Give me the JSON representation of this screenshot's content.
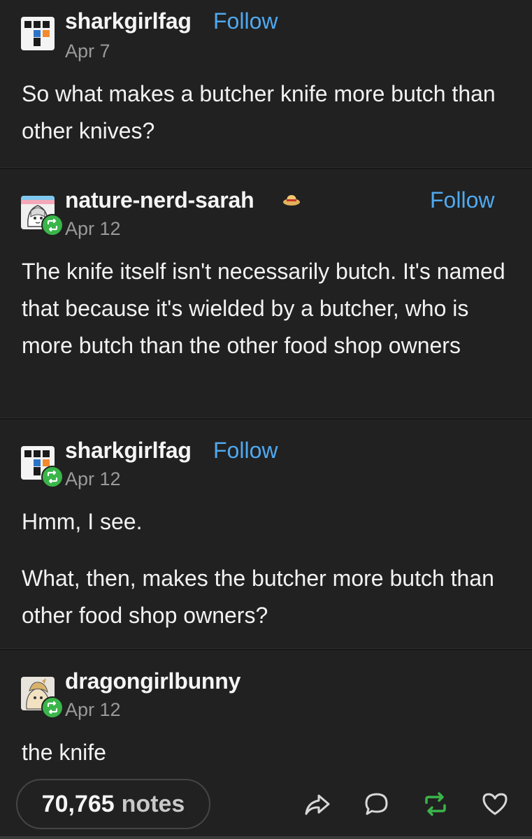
{
  "posts": [
    {
      "username": "sharkgirlfag",
      "follow_label": "Follow",
      "date": "Apr 7",
      "paragraphs": [
        "So what makes a butcher knife more butch than other knives?"
      ]
    },
    {
      "username": "nature-nerd-sarah",
      "badge_icon": "hat-icon",
      "follow_label": "Follow",
      "date": "Apr 12",
      "paragraphs": [
        "The knife itself isn't necessarily butch. It's named that because it's wielded by a butcher, who is more butch than the other food shop owners"
      ]
    },
    {
      "username": "sharkgirlfag",
      "follow_label": "Follow",
      "date": "Apr 12",
      "paragraphs": [
        "Hmm, I see.",
        "What, then, makes the butcher more butch than other food shop owners?"
      ]
    },
    {
      "username": "dragongirlbunny",
      "date": "Apr 12",
      "paragraphs": [
        "the knife"
      ]
    }
  ],
  "footer": {
    "notes_count": "70,765",
    "notes_label": "notes",
    "actions": [
      "share-icon",
      "reply-icon",
      "reblog-icon",
      "like-icon"
    ]
  },
  "colors": {
    "background": "#212121",
    "follow": "#4fa9f0",
    "reblog_green": "#3ab54a",
    "date": "#9a9a9a"
  }
}
